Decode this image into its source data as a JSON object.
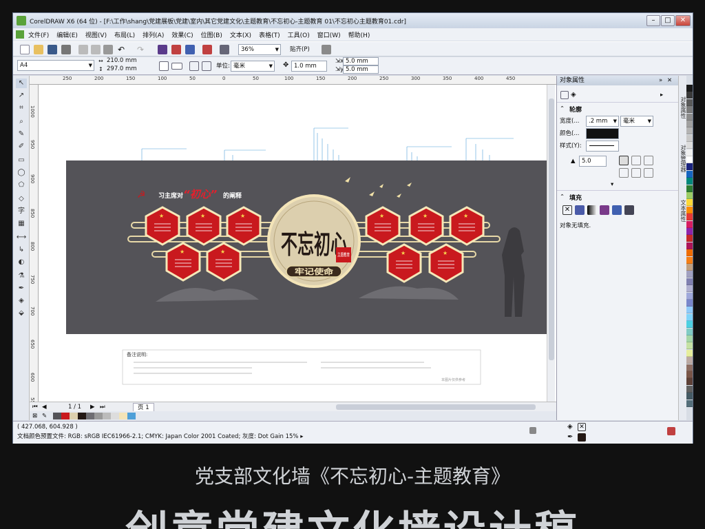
{
  "window": {
    "title": "CorelDRAW X6 (64 位) - [F:\\工作\\shang\\党建展板\\党建\\室内\\其它党建文化\\主题教育\\不忘初心-主题教育 01\\不忘初心主题教育01.cdr]"
  },
  "menu": [
    "文件(F)",
    "编辑(E)",
    "视图(V)",
    "布局(L)",
    "排列(A)",
    "效果(C)",
    "位图(B)",
    "文本(X)",
    "表格(T)",
    "工具(O)",
    "窗口(W)",
    "帮助(H)"
  ],
  "toolbar": {
    "zoom": "36%",
    "snap": "贴齐(P)"
  },
  "propbar": {
    "page_size": "A4",
    "width": "210.0 mm",
    "height": "297.0 mm",
    "unit_label": "单位:",
    "unit": "毫米",
    "nudge": "1.0 mm",
    "dup_x": "5.0 mm",
    "dup_y": "5.0 mm"
  },
  "ruler_top": [
    "250",
    "200",
    "150",
    "100",
    "50",
    "0",
    "50",
    "100",
    "150",
    "200",
    "250",
    "300",
    "350",
    "400",
    "450"
  ],
  "ruler_left": [
    "1000",
    "950",
    "900",
    "850",
    "800",
    "750",
    "700",
    "650",
    "600",
    "550"
  ],
  "artwork": {
    "heading_prefix": "习主席对",
    "heading_key": "“初心”",
    "heading_suffix": "的阐释",
    "center_big": "不忘初心",
    "seal": "主题教育",
    "banner": "牢记使命"
  },
  "notes": {
    "title": "备注说明:",
    "page_note": "本图片仅供参考"
  },
  "statusbar": {
    "coords": "( 427.068, 604.928 )",
    "color_profile": "文档颜色预置文件: RGB: sRGB IEC61966-2.1; CMYK: Japan Color 2001 Coated; 灰度: Dot Gain 15% ▸",
    "page_counter": "1 / 1",
    "page_tab": "页 1"
  },
  "docker": {
    "title": "对象属性",
    "outline_label": "轮廓",
    "width_label": "宽度(...",
    "width_value": ".2 mm",
    "width_unit": "毫米",
    "color_label": "颜色(...",
    "style_label": "样式(Y):",
    "miter_value": "5.0",
    "fill_label": "填充",
    "no_fill": "对象无填充."
  },
  "right_tabs": [
    "对象属性",
    "对象管理器",
    "文本属性"
  ],
  "bottom_caption": "党支部文化墙《不忘初心-主题教育》",
  "big_caption": "创意党建文化墙设计稿",
  "palette": [
    "#1a1a1a",
    "#3a3a3a",
    "#5a5a5a",
    "#7a7a7a",
    "#8c8c8c",
    "#a0a0a0",
    "#b4b4b4",
    "#c8c8c8",
    "#dcdcdc",
    "#f0f0f0",
    "#ffffff",
    "#1a237e",
    "#1565c0",
    "#00897b",
    "#2e7d32",
    "#9ccc65",
    "#fdd835",
    "#fb8c00",
    "#e53935",
    "#d81b60",
    "#8e24aa",
    "#c62828",
    "#ad1457",
    "#ef6c00",
    "#f57f17",
    "#c0a080",
    "#a0a0c0",
    "#8080b0",
    "#b0b0d0",
    "#9fa8da",
    "#7986cb",
    "#90caf9",
    "#81d4fa",
    "#4dd0e1",
    "#80cbc4",
    "#a5d6a7",
    "#c5e1a5",
    "#e6ee9c",
    "#bcaaa4",
    "#8d6e63",
    "#795548",
    "#5d4037",
    "#616161",
    "#455a64",
    "#546e7a"
  ]
}
